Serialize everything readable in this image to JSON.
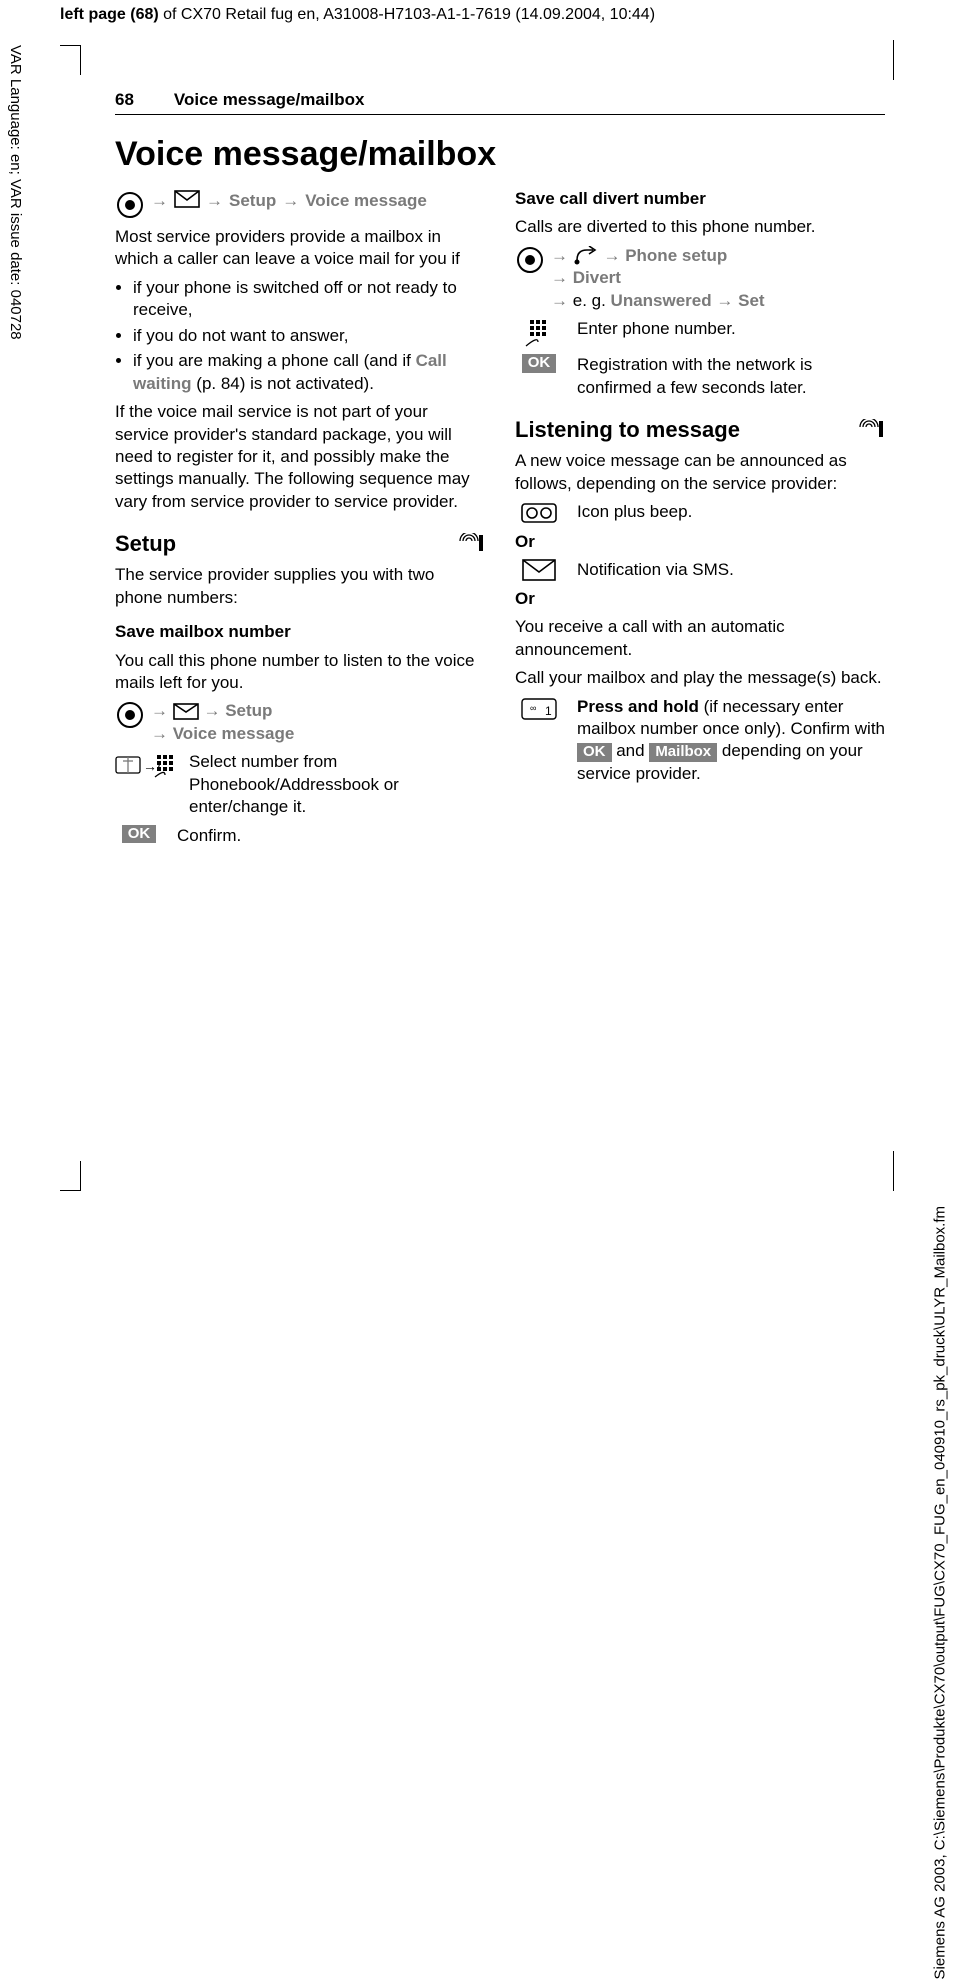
{
  "meta": {
    "top_line_prefix": "left page (68)",
    "top_line_rest": " of CX70 Retail fug en, A31008-H7103-A1-1-7619 (14.09.2004, 10:44)",
    "left_rotated": "VAR Language: en; VAR issue date: 040728",
    "right_rotated": "Siemens AG 2003, C:\\Siemens\\Produkte\\CX70\\output\\FUG\\CX70_FUG_en_040910_rs_pk_druck\\ULYR_Mailbox.fm"
  },
  "header": {
    "page_num": "68",
    "running_title": "Voice message/mailbox"
  },
  "h1": "Voice message/mailbox",
  "left": {
    "nav_setup": {
      "setup": "Setup",
      "voice_message": "Voice message"
    },
    "intro": "Most service providers provide a mailbox in which a caller can leave a voice mail for you if",
    "bullets": {
      "b1": "if your phone is switched off or not ready to receive,",
      "b2": "if you do not want to answer,",
      "b3_pre": "if you are making a phone call (and if ",
      "b3_call_waiting": "Call waiting",
      "b3_post": " (p. 84) is not activated)."
    },
    "para2": "If the voice mail service is not part of your service provider's standard package, you will need to register for it, and possibly make the settings manually. The following sequence may vary from service provider to service provider.",
    "setup_heading": "Setup",
    "setup_intro": "The service provider supplies you with two phone numbers:",
    "save_mailbox_heading": "Save mailbox number",
    "save_mailbox_text": "You call this phone number to listen to the voice mails left for you.",
    "nav2": {
      "setup": "Setup",
      "voice_message": "Voice message"
    },
    "select_number": "Select number from Phonebook/Addressbook or enter/change it.",
    "ok": "OK",
    "confirm": "Confirm."
  },
  "right": {
    "save_divert_heading": "Save call divert number",
    "divert_text": "Calls are diverted to this phone number.",
    "nav3": {
      "phone_setup": "Phone setup",
      "divert": "Divert",
      "eg_pre": "e. g. ",
      "unanswered": "Unanswered",
      "set": "Set"
    },
    "enter_number": "Enter phone number.",
    "ok": "OK",
    "registration": "Registration with the network is confirmed a few seconds later.",
    "listen_heading": "Listening to message",
    "listen_intro": "A new voice message can be announced as follows, depending on the service provider:",
    "icon_beep": "Icon plus beep.",
    "or": "Or",
    "sms": "Notification via SMS.",
    "or2": "Or",
    "auto_call": "You receive a call with an automatic announcement.",
    "play_back": "Call your mailbox and play the message(s) back.",
    "press_hold_pre": "Press and hold",
    "press_hold_mid1": " (if necessary enter mailbox number once only). Confirm with ",
    "press_hold_ok": "OK",
    "press_hold_mid2": " and ",
    "press_hold_mailbox": "Mailbox",
    "press_hold_post": " depending on your service provider."
  }
}
